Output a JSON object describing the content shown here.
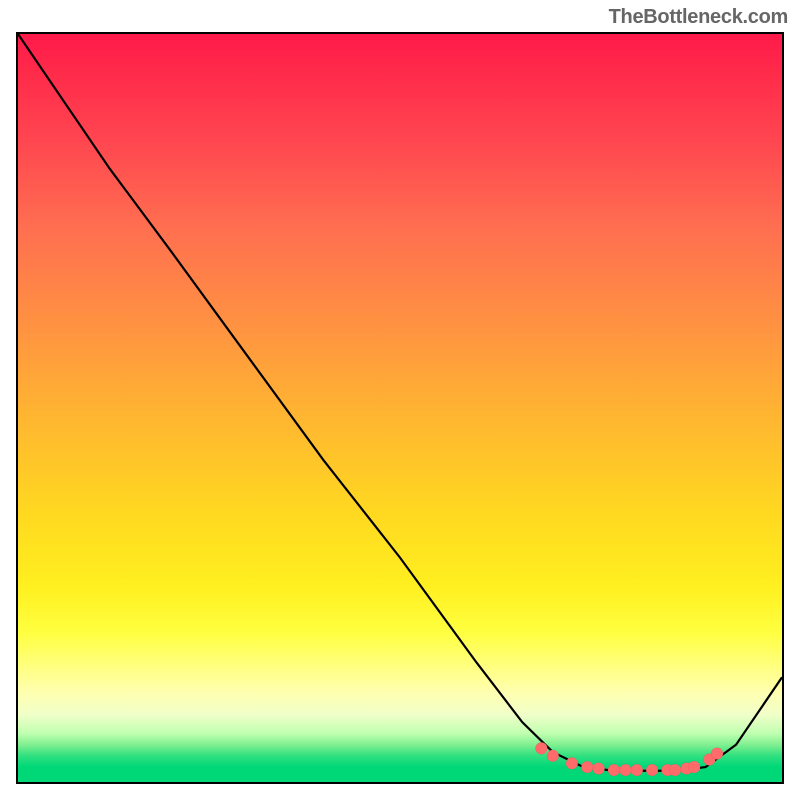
{
  "watermark": "TheBottleneck.com",
  "chart_data": {
    "type": "line",
    "title": "",
    "xlabel": "",
    "ylabel": "",
    "xlim": [
      0,
      100
    ],
    "ylim": [
      0,
      100
    ],
    "curve": {
      "x": [
        0,
        8,
        12,
        20,
        30,
        40,
        50,
        60,
        66,
        70,
        74,
        78,
        82,
        86,
        90,
        94,
        100
      ],
      "y": [
        100,
        88,
        82,
        71,
        57,
        43,
        30,
        16,
        8,
        4,
        2,
        1.5,
        1.5,
        1.5,
        2,
        5,
        14
      ]
    },
    "dots": {
      "x": [
        68.5,
        70.0,
        72.5,
        74.5,
        76.0,
        78.0,
        79.5,
        81.0,
        83.0,
        85.0,
        86.0,
        87.5,
        88.5,
        90.5,
        91.5
      ],
      "y": [
        4.5,
        3.5,
        2.5,
        2.0,
        1.8,
        1.6,
        1.6,
        1.6,
        1.6,
        1.6,
        1.6,
        1.8,
        2.0,
        3.0,
        3.8
      ]
    }
  }
}
